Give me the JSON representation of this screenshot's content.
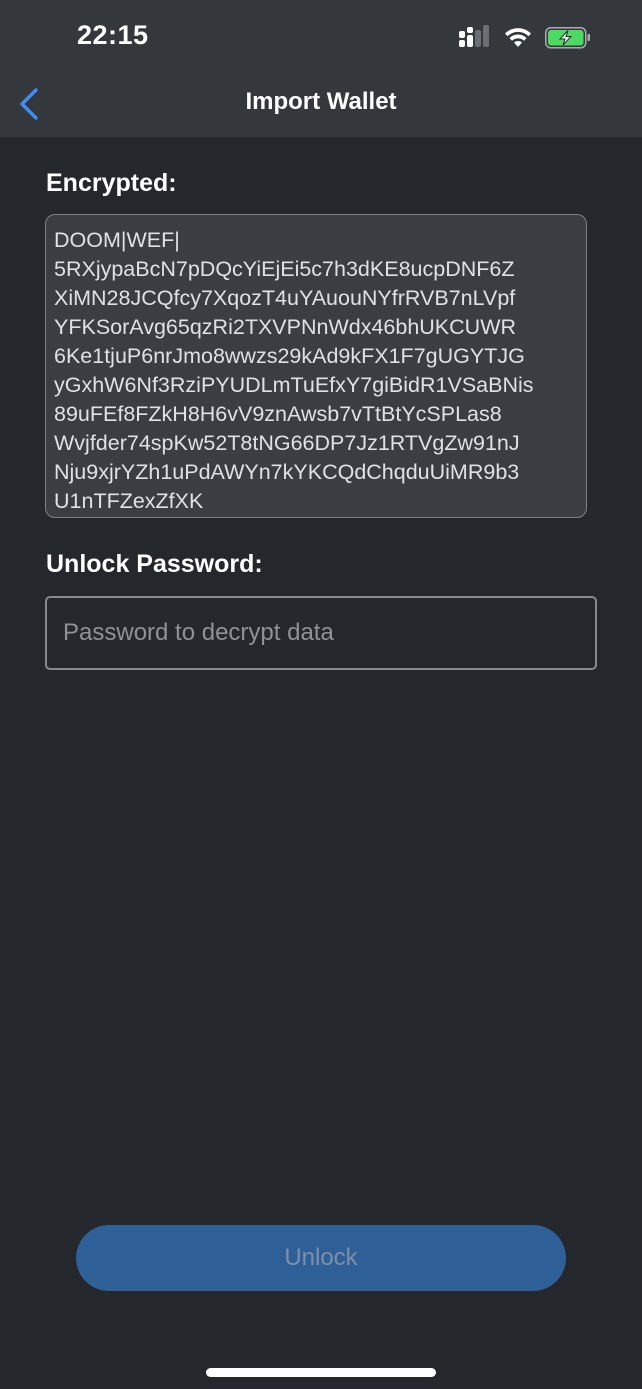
{
  "status_bar": {
    "time": "22:15",
    "icons": [
      "cellular-signal-icon",
      "wifi-icon",
      "battery-charging-icon"
    ],
    "battery_color": "#4cd964"
  },
  "nav": {
    "title": "Import Wallet",
    "back_icon": "chevron-left-icon",
    "accent_color": "#3d8ef0"
  },
  "encrypted": {
    "label": "Encrypted:",
    "value": "DOOM|WEF|\n5RXjypaBcN7pDQcYiEjEi5c7h3dKE8ucpDNF6Z\nXiMN28JCQfcy7XqozT4uYAuouNYfrRVB7nLVpf\nYFKSorAvg65qzRi2TXVPNnWdx46bhUKCUWR\n6Ke1tjuP6nrJmo8wwzs29kAd9kFX1F7gUGYTJG\nyGxhW6Nf3RziPYUDLmTuEfxY7giBidR1VSaBNis\n89uFEf8FZkH8H6vV9znAwsb7vTtBtYcSPLas8\nWvjfder74spKw52T8tNG66DP7Jz1RTVgZw91nJ\nNju9xjrYZh1uPdAWYn7kYKCQdChqduUiMR9b3\nU1nTFZexZfXK"
  },
  "password": {
    "label": "Unlock Password:",
    "value": "",
    "placeholder": "Password to decrypt data"
  },
  "actions": {
    "unlock_label": "Unlock",
    "unlock_color": "#2e5f96"
  }
}
